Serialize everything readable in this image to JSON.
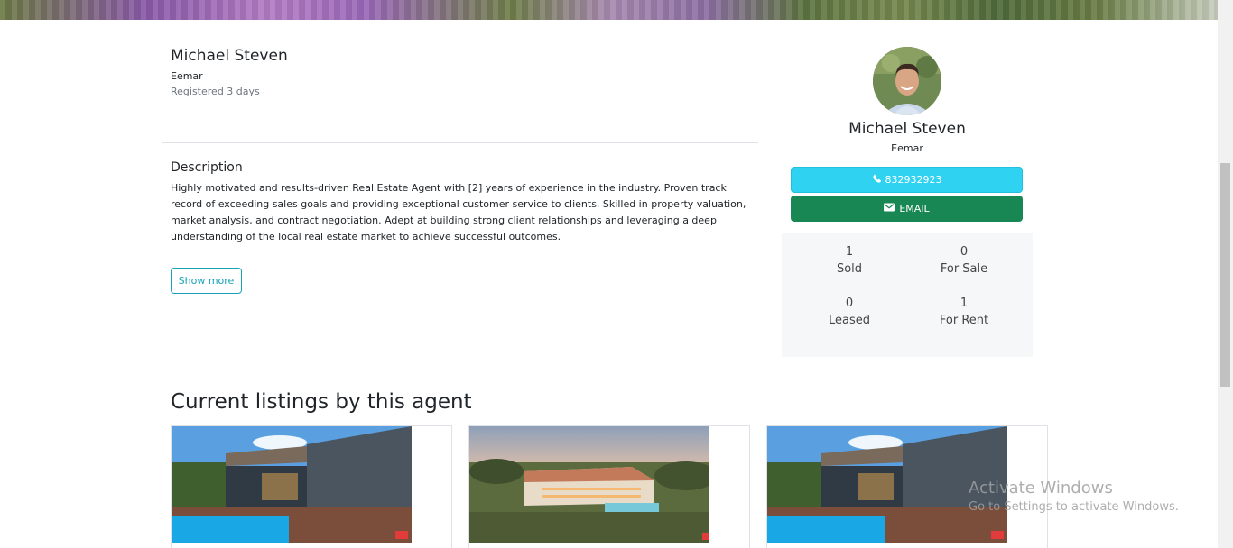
{
  "agent": {
    "name": "Michael Steven",
    "company": "Eemar",
    "registered": "Registered 3 days"
  },
  "description": {
    "title": "Description",
    "text": "Highly motivated and results-driven Real Estate Agent with [2] years of experience in the industry. Proven track record of exceeding sales goals and providing exceptional customer service to clients. Skilled in property valuation, market analysis, and contract negotiation. Adept at building strong client relationships and leveraging a deep understanding of the local real estate market to achieve successful outcomes.",
    "show_more_label": "Show more"
  },
  "contact_card": {
    "name": "Michael Steven",
    "company": "Eemar",
    "phone": "832932923",
    "email_label": "EMAIL",
    "phone_icon": "phone-icon",
    "email_icon": "envelope-icon",
    "accent_phone": "#2fd2f1",
    "accent_email": "#198754"
  },
  "stats": [
    {
      "value": "1",
      "label": "Sold"
    },
    {
      "value": "0",
      "label": "For Sale"
    },
    {
      "value": "0",
      "label": "Leased"
    },
    {
      "value": "1",
      "label": "For Rent"
    }
  ],
  "listings": {
    "title": "Current listings by this agent"
  },
  "watermark": {
    "line1": "Activate Windows",
    "line2": "Go to Settings to activate Windows."
  }
}
